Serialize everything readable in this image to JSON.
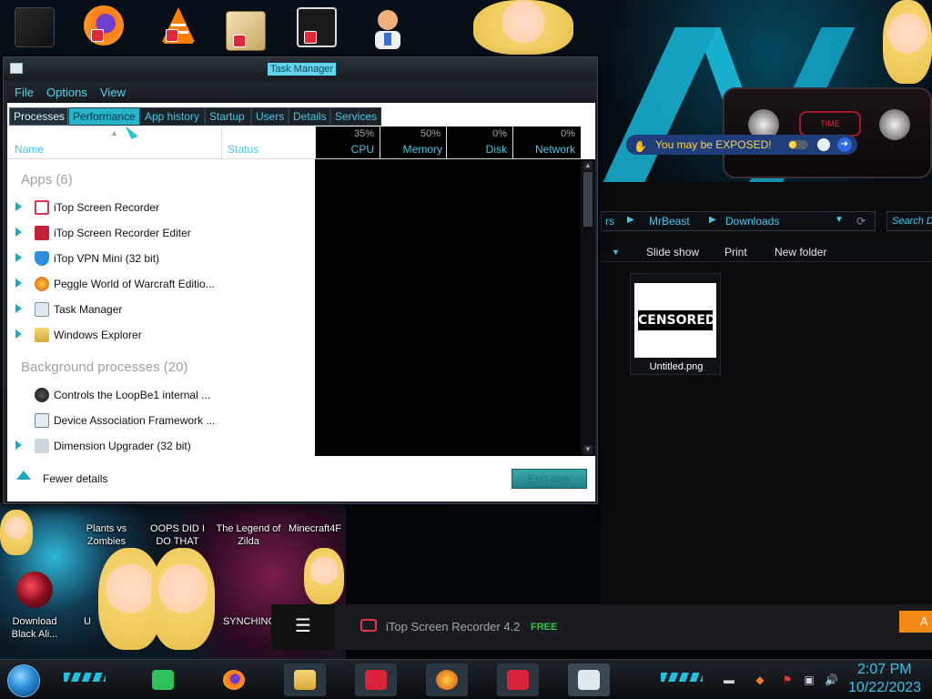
{
  "task_manager": {
    "title": "Task Manager",
    "menu": [
      "File",
      "Options",
      "View"
    ],
    "tabs": [
      "Processes",
      "Performance",
      "App history",
      "Startup",
      "Users",
      "Details",
      "Services"
    ],
    "columns": {
      "name": "Name",
      "status": "Status",
      "cpu": {
        "label": "CPU",
        "pct": "35%"
      },
      "memory": {
        "label": "Memory",
        "pct": "50%"
      },
      "disk": {
        "label": "Disk",
        "pct": "0%"
      },
      "network": {
        "label": "Network",
        "pct": "0%"
      }
    },
    "apps_header": "Apps (6)",
    "apps": [
      "iTop Screen Recorder",
      "iTop Screen Recorder Editer",
      "iTop VPN Mini (32 bit)",
      "Peggle World of Warcraft Editio...",
      "Task Manager",
      "Windows Explorer"
    ],
    "background_header": "Background processes (20)",
    "background": [
      "Controls the LoopBe1 internal ...",
      "Device Association Framework ...",
      "Dimension Upgrader (32 bit)"
    ],
    "fewer_details": "Fewer details",
    "end_task": "End task"
  },
  "explorer": {
    "breadcrumb": [
      "rs",
      "MrBeast",
      "Downloads"
    ],
    "search_placeholder": "Search D",
    "commands": [
      "Slide show",
      "Print",
      "New folder"
    ],
    "file_name": "Untitled.png",
    "thumbnail_text": "CENSORED"
  },
  "vpn_banner": "You may be EXPOSED!",
  "desktop_icons": [
    "Plants vs Zombies",
    "OOPS DID I DO THAT",
    "The Legend of Zilda",
    "Minecraft4F",
    "Download Black Ali...",
    "U",
    "SYNCHING"
  ],
  "itop_bar": {
    "title": "iTop Screen Recorder 4.2",
    "badge": "FREE",
    "cta": "A"
  },
  "taskbar": {
    "time": "2:07 PM",
    "date": "10/22/2023"
  },
  "colors": {
    "accent": "#46c8e6",
    "itop_free": "#36c24a",
    "itop_cta": "#f28a14",
    "banner_bg": "#1e3d7a",
    "banner_text": "#ffd24a"
  }
}
